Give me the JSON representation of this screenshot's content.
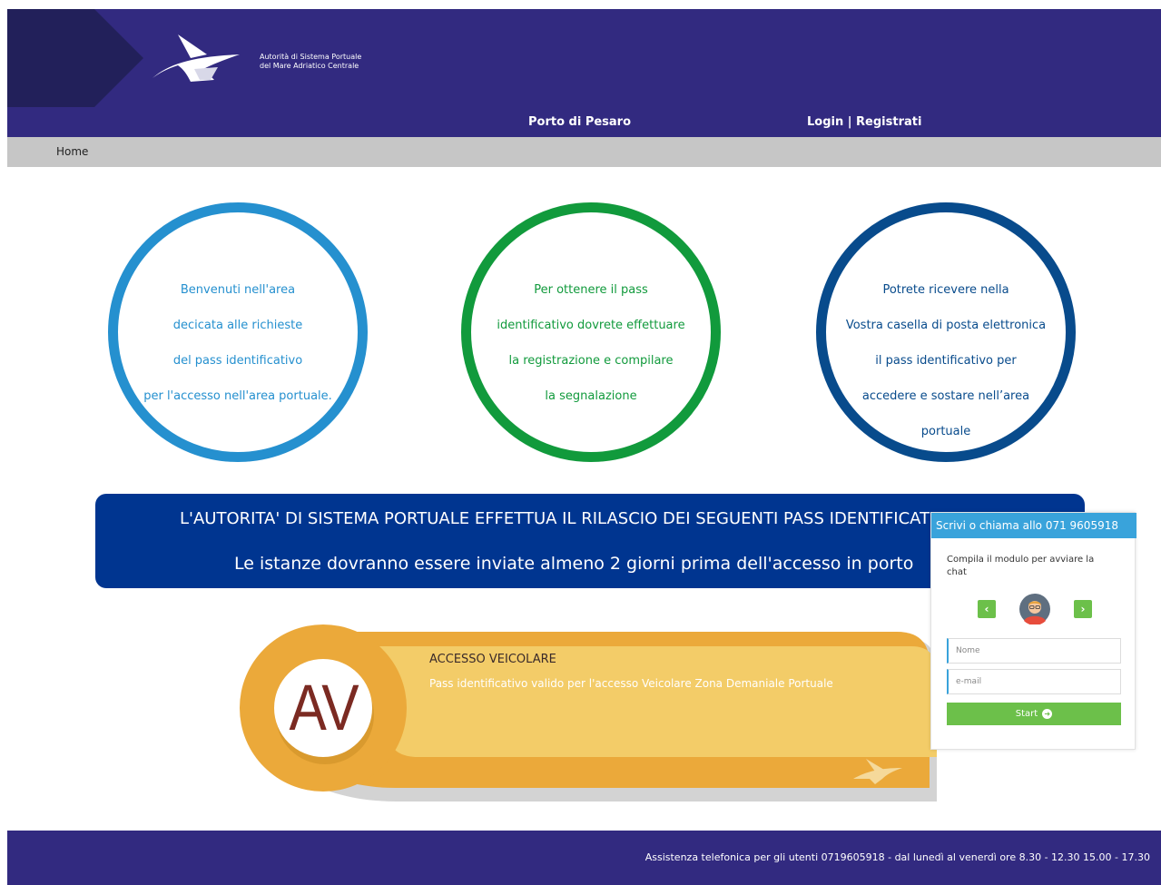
{
  "header": {
    "org_line1": "Autorità di Sistema Portuale",
    "org_line2": "del Mare Adriatico Centrale",
    "port_name": "Porto di Pesaro",
    "login_label": "Login",
    "separator": "|",
    "register_label": "Registrati",
    "color_bg": "#322a80"
  },
  "breadcrumb": {
    "home_label": "Home"
  },
  "circles": [
    {
      "lines": [
        "Benvenuti nell'area",
        "decicata alle richieste",
        "del pass identificativo",
        "per l'accesso nell'area portuale."
      ],
      "color": "#2590cf"
    },
    {
      "lines": [
        "Per ottenere il pass",
        "identificativo dovrete effettuare",
        "la registrazione e compilare",
        "la segnalazione"
      ],
      "color": "#119a3c"
    },
    {
      "lines": [
        "Potrete ricevere nella",
        "Vostra casella di posta elettronica",
        "il pass identificativo per",
        "accedere e sostare nell’area",
        "portuale"
      ],
      "color": "#084b8c"
    }
  ],
  "banner": {
    "line1": "L'AUTORITA' DI SISTEMA PORTUALE EFFETTUA IL RILASCIO DEI SEGUENTI PASS IDENTIFICATIVI",
    "line2": "Le istanze dovranno essere inviate almeno 2 giorni prima dell'accesso in porto",
    "color_bg": "#003590"
  },
  "card": {
    "badge": "AV",
    "title": "ACCESSO VEICOLARE",
    "description": "Pass identificativo valido per l'accesso Veicolare Zona Demaniale Portuale",
    "color_primary": "#eba93a",
    "color_secondary": "#f3cc68"
  },
  "chat": {
    "header": "Scrivi o chiama allo 071 9605918",
    "prompt": "Compila il modulo per avviare la chat",
    "prev_icon": "chevron-left-icon",
    "next_icon": "chevron-right-icon",
    "name_placeholder": "Nome",
    "email_placeholder": "e-mail",
    "start_label": "Start",
    "color_header": "#39a3db",
    "color_button": "#6cc04a"
  },
  "footer": {
    "text": "Assistenza telefonica per gli utenti 0719605918 - dal lunedì al venerdì ore 8.30 - 12.30 15.00 - 17.30"
  }
}
